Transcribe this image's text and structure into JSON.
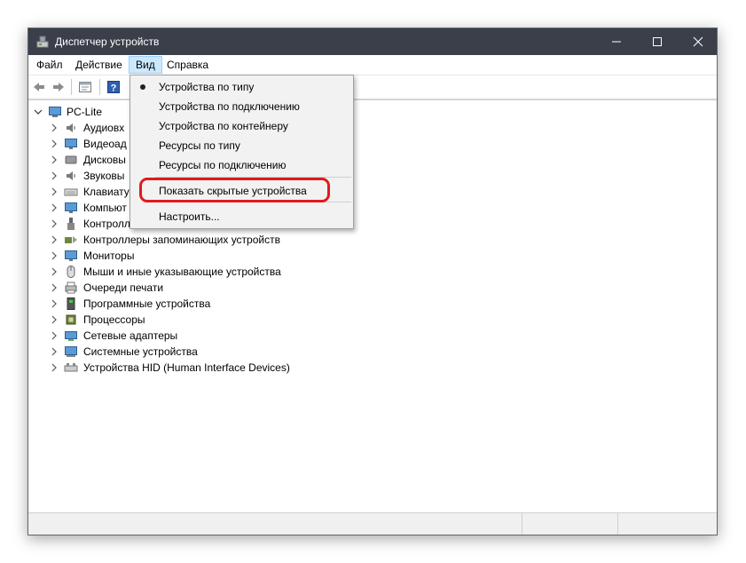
{
  "window": {
    "title": "Диспетчер устройств"
  },
  "menubar": {
    "items": [
      {
        "label": "Файл"
      },
      {
        "label": "Действие"
      },
      {
        "label": "Вид"
      },
      {
        "label": "Справка"
      }
    ]
  },
  "tree": {
    "root": "PC-Lite",
    "items": [
      {
        "label": "Аудиовх",
        "icon": "speaker-icon"
      },
      {
        "label": "Видеоад",
        "icon": "monitor-icon"
      },
      {
        "label": "Дисковы",
        "icon": "disk-icon"
      },
      {
        "label": "Звуковы",
        "icon": "speaker-icon"
      },
      {
        "label": "Клавиату",
        "icon": "keyboard-icon"
      },
      {
        "label": "Компьют",
        "icon": "monitor-icon"
      },
      {
        "label": "Контролл",
        "icon": "usb-icon"
      },
      {
        "label": "Контроллеры запоминающих устройств",
        "icon": "storage-controller-icon"
      },
      {
        "label": "Мониторы",
        "icon": "monitor-icon"
      },
      {
        "label": "Мыши и иные указывающие устройства",
        "icon": "mouse-icon"
      },
      {
        "label": "Очереди печати",
        "icon": "printer-icon"
      },
      {
        "label": "Программные устройства",
        "icon": "software-device-icon"
      },
      {
        "label": "Процессоры",
        "icon": "cpu-icon"
      },
      {
        "label": "Сетевые адаптеры",
        "icon": "network-adapter-icon"
      },
      {
        "label": "Системные устройства",
        "icon": "system-device-icon"
      },
      {
        "label": "Устройства HID (Human Interface Devices)",
        "icon": "hid-icon"
      }
    ]
  },
  "view_menu": {
    "items": [
      {
        "label": "Устройства по типу",
        "selected": true
      },
      {
        "label": "Устройства по подключению",
        "selected": false
      },
      {
        "label": "Устройства по контейнеру",
        "selected": false
      },
      {
        "label": "Ресурсы по типу",
        "selected": false
      },
      {
        "label": "Ресурсы по подключению",
        "selected": false
      },
      {
        "label": "Показать скрытые устройства",
        "selected": false,
        "highlighted": true
      },
      {
        "label": "Настроить...",
        "selected": false
      }
    ]
  },
  "colors": {
    "titlebar": "#3a3f4a",
    "menu_active": "#cce8ff",
    "highlight": "#e01b1b"
  }
}
